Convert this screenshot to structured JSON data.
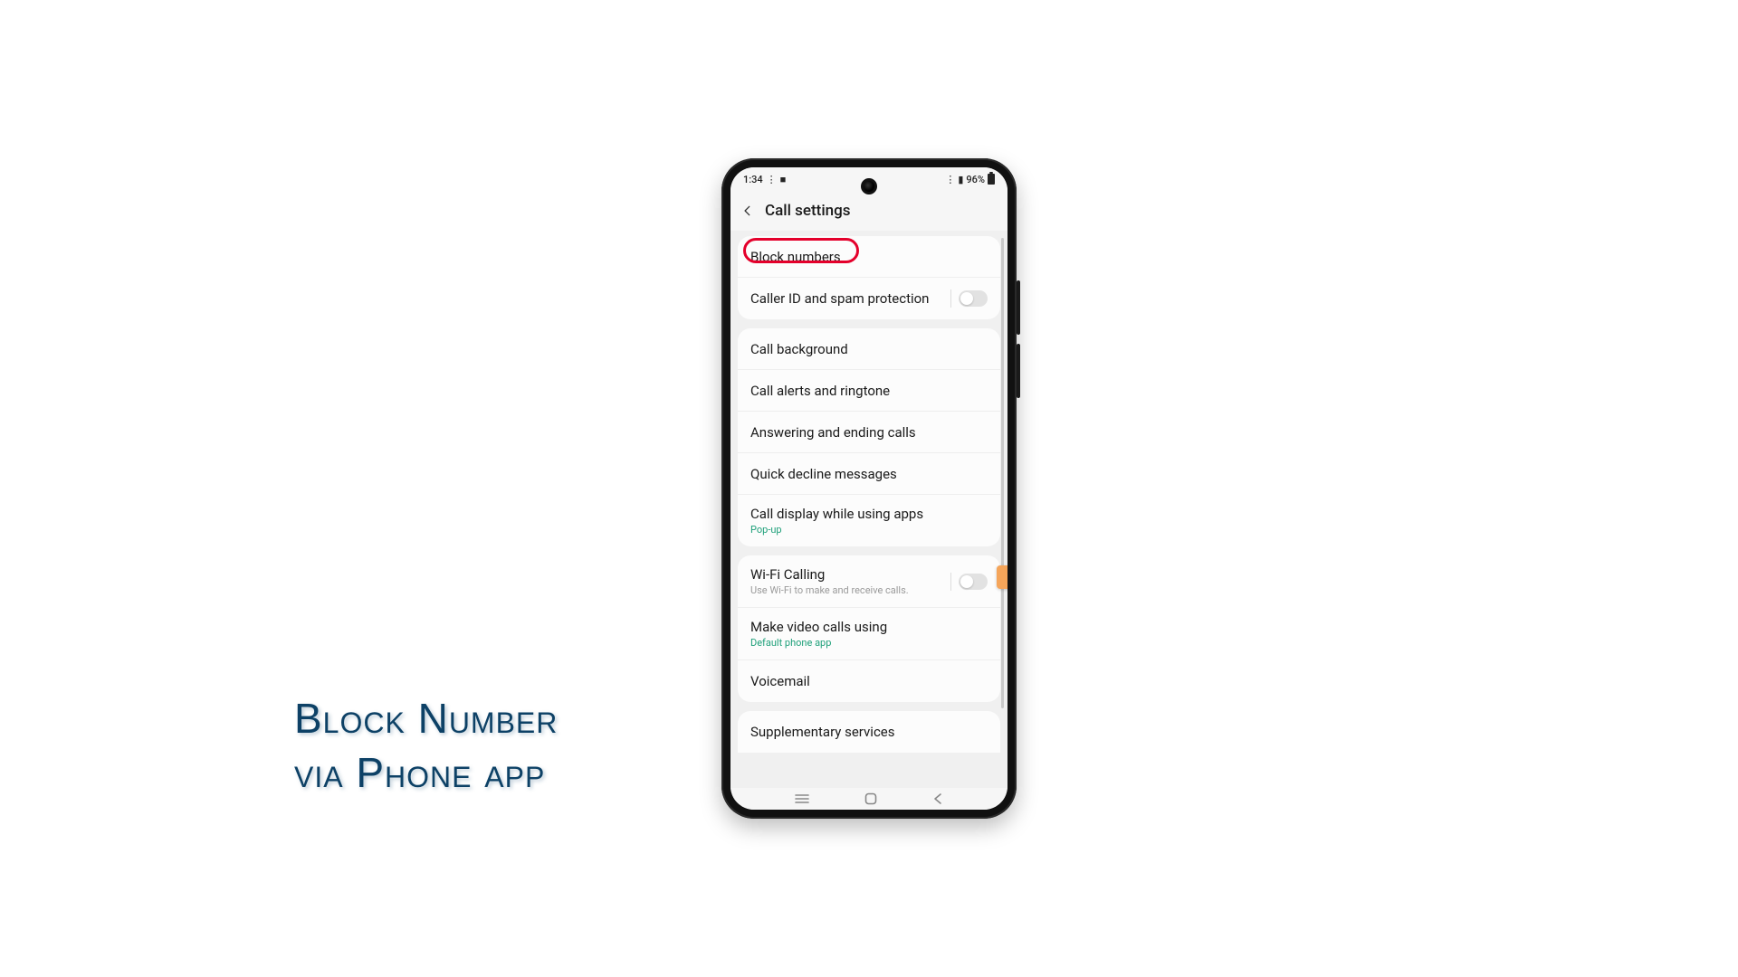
{
  "statusbar": {
    "time": "1:34",
    "battery_pct": "96%"
  },
  "header": {
    "title": "Call settings"
  },
  "groups": [
    {
      "rows": [
        {
          "title": "Block numbers",
          "highlighted": true
        },
        {
          "title": "Caller ID and spam protection",
          "toggle": true,
          "toggle_on": false
        }
      ]
    },
    {
      "rows": [
        {
          "title": "Call background"
        },
        {
          "title": "Call alerts and ringtone"
        },
        {
          "title": "Answering and ending calls"
        },
        {
          "title": "Quick decline messages"
        },
        {
          "title": "Call display while using apps",
          "sub": "Pop-up",
          "sub_accent": true
        }
      ]
    },
    {
      "rows": [
        {
          "title": "Wi-Fi Calling",
          "sub": "Use Wi-Fi to make and receive calls.",
          "toggle": true,
          "toggle_on": false
        },
        {
          "title": "Make video calls using",
          "sub": "Default phone app",
          "sub_accent": true
        },
        {
          "title": "Voicemail"
        }
      ]
    },
    {
      "rows": [
        {
          "title": "Supplementary services"
        }
      ]
    }
  ],
  "caption": {
    "line1": "Block Number",
    "line2": "via Phone app"
  }
}
